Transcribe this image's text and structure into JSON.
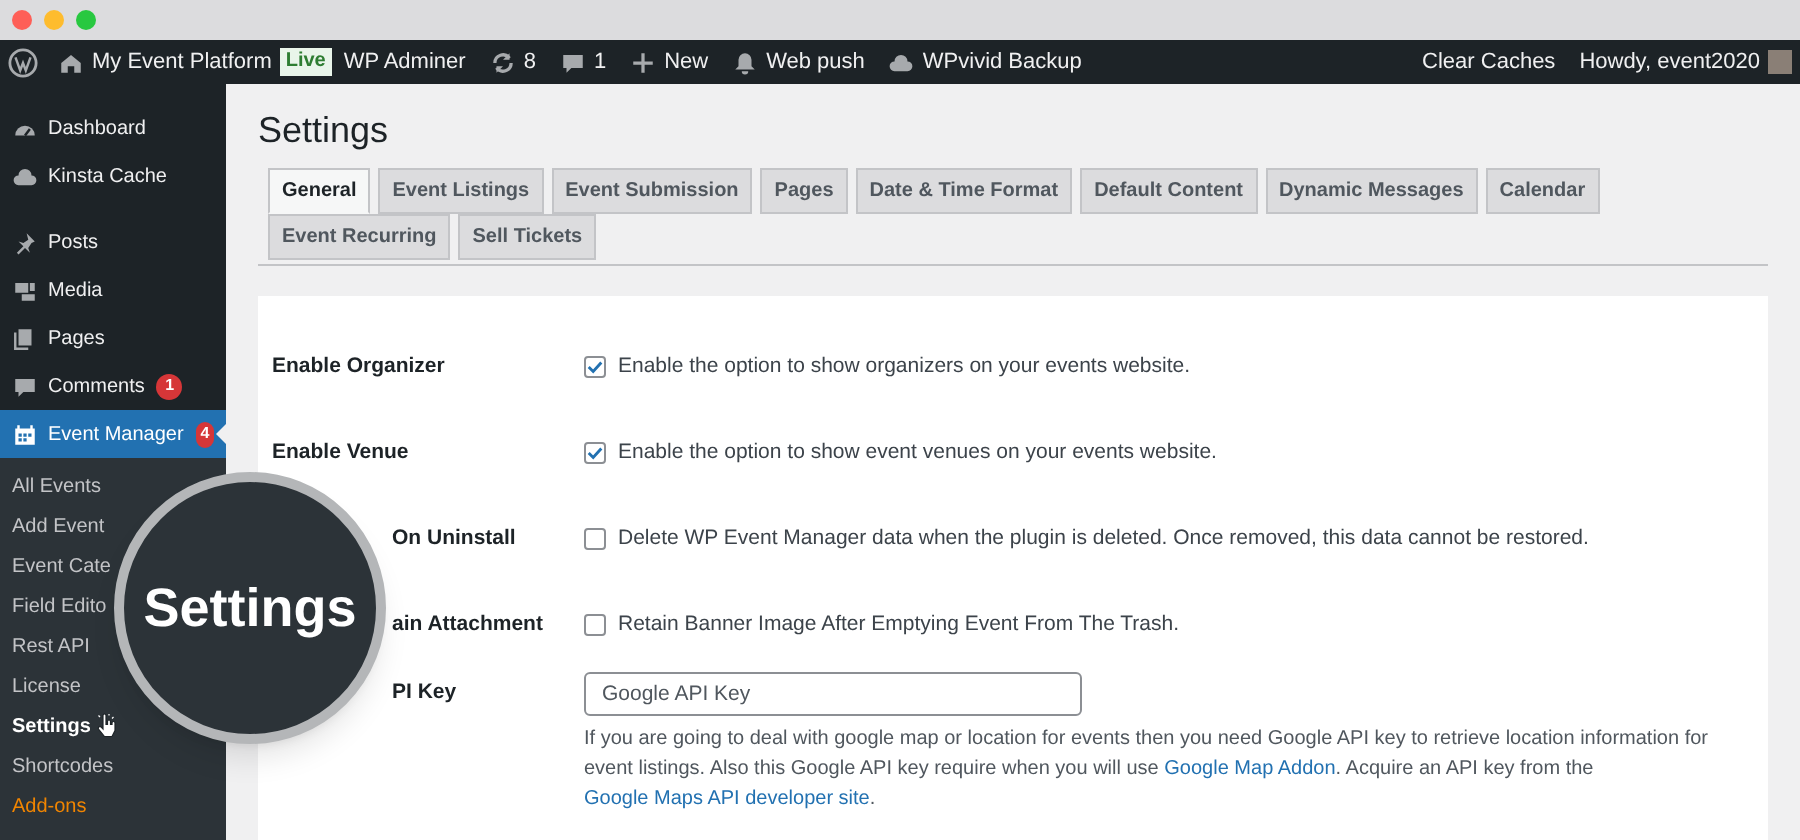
{
  "admin_bar": {
    "site": "My Event Platform",
    "badge": "Live",
    "items": [
      {
        "kind": "text",
        "label": "WP Adminer"
      },
      {
        "kind": "updates",
        "label": "8"
      },
      {
        "kind": "comments",
        "label": "1"
      },
      {
        "kind": "new",
        "label": "New"
      },
      {
        "kind": "bell",
        "label": "Web push"
      },
      {
        "kind": "cloud",
        "label": "WPvivid Backup"
      }
    ],
    "right": [
      "Clear Caches",
      "Howdy, event2020"
    ]
  },
  "sidebar": {
    "items": [
      {
        "kind": "dashboard",
        "label": "Dashboard",
        "selected": false
      },
      {
        "kind": "cloud",
        "label": "Kinsta Cache",
        "selected": false
      },
      {
        "kind": "pin",
        "label": "Posts",
        "selected": false
      },
      {
        "kind": "media",
        "label": "Media",
        "selected": false
      },
      {
        "kind": "pages",
        "label": "Pages",
        "selected": false
      },
      {
        "kind": "comment",
        "label": "Comments",
        "count": "1",
        "selected": false
      },
      {
        "kind": "calendar",
        "label": "Event Manager",
        "count": "4",
        "selected": true
      }
    ],
    "submenu": [
      {
        "label": "All Events",
        "selected": false,
        "kind": "normal"
      },
      {
        "label": "Add Event",
        "selected": false,
        "kind": "normal"
      },
      {
        "label": "Event Cate",
        "selected": false,
        "kind": "normal"
      },
      {
        "label": "Field Edito",
        "selected": false,
        "kind": "normal"
      },
      {
        "label": "Rest API",
        "selected": false,
        "kind": "normal"
      },
      {
        "label": "License",
        "selected": false,
        "kind": "normal"
      },
      {
        "label": "Settings",
        "selected": true,
        "kind": "normal"
      },
      {
        "label": "Shortcodes",
        "selected": false,
        "kind": "normal"
      },
      {
        "label": "Add-ons",
        "selected": false,
        "kind": "addon"
      }
    ]
  },
  "page": {
    "title": "Settings",
    "tabs": [
      {
        "label": "General",
        "selected": true
      },
      {
        "label": "Event Listings",
        "selected": false
      },
      {
        "label": "Event Submission",
        "selected": false
      },
      {
        "label": "Pages",
        "selected": false
      },
      {
        "label": "Date & Time Format",
        "selected": false
      },
      {
        "label": "Default Content",
        "selected": false
      },
      {
        "label": "Dynamic Messages",
        "selected": false
      },
      {
        "label": "Calendar",
        "selected": false
      },
      {
        "label": "Event Recurring",
        "selected": false
      },
      {
        "label": "Sell Tickets",
        "selected": false
      }
    ],
    "rows": [
      {
        "kind": "checkbox",
        "label": "Enable Organizer",
        "covered": false,
        "checked": true,
        "text": "Enable the option to show organizers on your events website."
      },
      {
        "kind": "checkbox",
        "label": "Enable Venue",
        "covered": false,
        "checked": true,
        "text": "Enable the option to show event venues on your events website."
      },
      {
        "kind": "checkbox",
        "label": "On Uninstall",
        "covered": true,
        "checked": false,
        "text": "Delete WP Event Manager data when the plugin is deleted. Once removed, this data cannot be restored."
      },
      {
        "kind": "checkbox",
        "label": "ain Attachment",
        "covered": true,
        "checked": false,
        "text": "Retain Banner Image After Emptying Event From The Trash."
      },
      {
        "kind": "text",
        "label": "PI Key",
        "covered": true,
        "placeholder": "Google API Key",
        "help": [
          "If you are going to deal with google map or location for events then you need Google API key to retrieve location information for event listings. Also this Google API key require when you will use ",
          {
            "link": "Google Map Addon"
          },
          ". Acquire an API key from the ",
          {
            "link": "Google Maps API developer site"
          },
          "."
        ]
      }
    ]
  },
  "magnifier": {
    "text": "Settings"
  }
}
